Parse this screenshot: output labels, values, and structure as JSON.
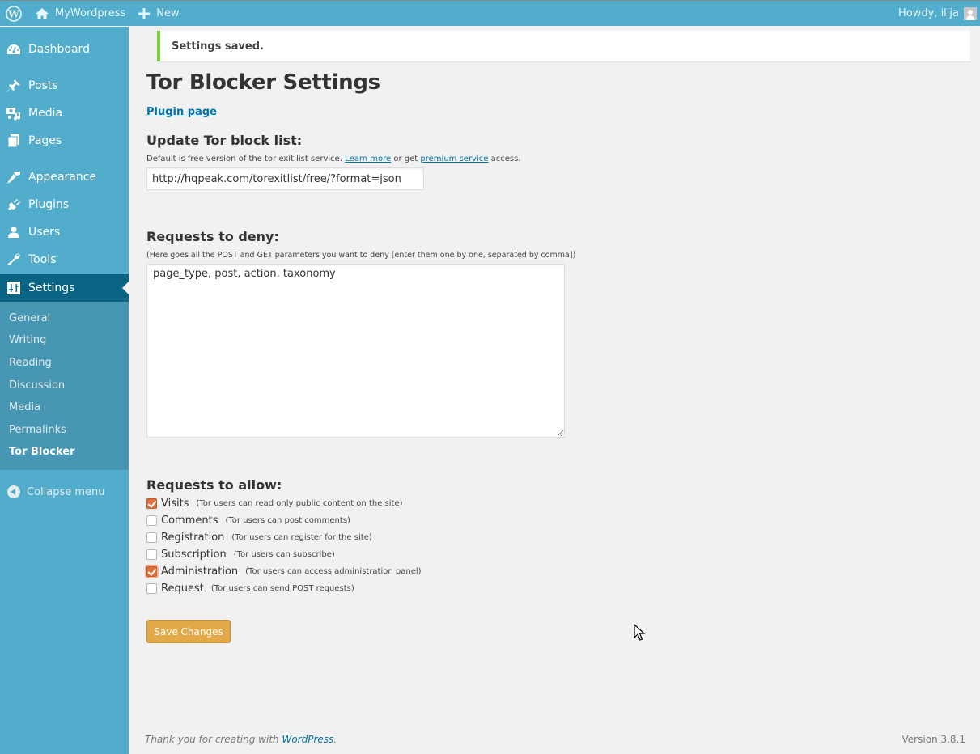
{
  "admin_bar": {
    "wp_logo_icon": "wordpress-logo-icon",
    "site_name": "MyWordpress",
    "site_icon": "home-icon",
    "new_label": "New",
    "new_icon": "plus-icon",
    "greeting": "Howdy, ilija",
    "avatar_icon": "user-avatar-icon"
  },
  "sidebar": {
    "menu": [
      {
        "label": "Dashboard",
        "icon": "dashboard-icon"
      },
      {
        "label": "Posts",
        "icon": "pushpin-icon"
      },
      {
        "label": "Media",
        "icon": "media-icon"
      },
      {
        "label": "Pages",
        "icon": "pages-icon"
      },
      {
        "label": "Appearance",
        "icon": "paintbrush-icon"
      },
      {
        "label": "Plugins",
        "icon": "plug-icon"
      },
      {
        "label": "Users",
        "icon": "user-icon"
      },
      {
        "label": "Tools",
        "icon": "wrench-icon"
      },
      {
        "label": "Settings",
        "icon": "settings-icon",
        "current": true
      }
    ],
    "submenu": [
      {
        "label": "General"
      },
      {
        "label": "Writing"
      },
      {
        "label": "Reading"
      },
      {
        "label": "Discussion"
      },
      {
        "label": "Media"
      },
      {
        "label": "Permalinks"
      },
      {
        "label": "Tor Blocker",
        "current": true
      }
    ],
    "collapse_label": "Collapse menu"
  },
  "notice": {
    "text": "Settings saved.",
    "color": "#7ad03a"
  },
  "page": {
    "title": "Tor Blocker Settings",
    "plugin_link": "Plugin page",
    "update": {
      "heading": "Update Tor block list:",
      "desc_prefix": "Default is free version of the tor exit list service.",
      "learn_more": "Learn more",
      "desc_mid": "or get",
      "premium": "premium service",
      "desc_suffix": "access.",
      "url_value": "http://hqpeak.com/torexitlist/free/?format=json"
    },
    "deny": {
      "heading": "Requests to deny:",
      "desc": "(Here goes all the POST and GET parameters you want to deny [enter them one by one, separated by comma])",
      "value": "page_type, post, action, taxonomy"
    },
    "allow": {
      "heading": "Requests to allow:",
      "options": [
        {
          "label": "Visits",
          "desc": "(Tor users can read only public content on the site)",
          "checked": true
        },
        {
          "label": "Comments",
          "desc": "(Tor users can post comments)",
          "checked": false
        },
        {
          "label": "Registration",
          "desc": "(Tor users can register for the site)",
          "checked": false
        },
        {
          "label": "Subscription",
          "desc": "(Tor users can subscribe)",
          "checked": false
        },
        {
          "label": "Administration",
          "desc": "(Tor users can access administration panel)",
          "checked": true
        },
        {
          "label": "Request",
          "desc": "(Tor users can send POST requests)",
          "checked": false
        }
      ]
    },
    "save_label": "Save Changes"
  },
  "footer": {
    "thanks_prefix": "Thank you for creating with",
    "wp_link": "WordPress",
    "thanks_suffix": ".",
    "version": "Version 3.8.1"
  },
  "colors": {
    "admin_bar": "#52accc",
    "sidebar_current": "#096484",
    "submenu_bg": "#4796b3",
    "primary_button": "#e3a948",
    "checkbox_checked": "#e0703e",
    "link": "#0073aa"
  }
}
